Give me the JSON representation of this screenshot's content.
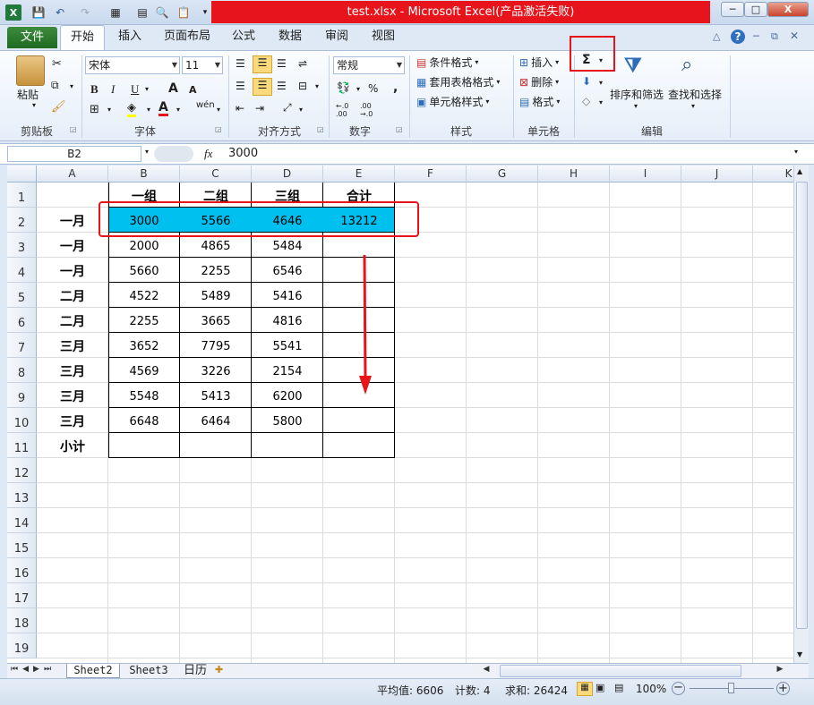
{
  "window": {
    "title": "test.xlsx  -  Microsoft Excel(产品激活失败)",
    "controls": {
      "minimize": "─",
      "maximize": "□",
      "close": "X"
    }
  },
  "ribbon_tabs": [
    "文件",
    "开始",
    "插入",
    "页面布局",
    "公式",
    "数据",
    "审阅",
    "视图"
  ],
  "clipboard": {
    "paste": "粘贴",
    "group": "剪贴板"
  },
  "font": {
    "name": "宋体",
    "size": "11",
    "bold": "B",
    "italic": "I",
    "underline": "U",
    "grow": "A",
    "shrink": "A",
    "color_letter": "A",
    "phonetic": "wén",
    "group": "字体"
  },
  "alignment": {
    "group": "对齐方式"
  },
  "number": {
    "format": "常规",
    "percent": "%",
    "comma": ",",
    "inc": "←.0 .00",
    "dec": ".00 →.0",
    "group": "数字"
  },
  "styles": {
    "conditional": "条件格式",
    "table": "套用表格格式",
    "cell": "单元格样式",
    "group": "样式"
  },
  "cells": {
    "insert": "插入",
    "delete": "删除",
    "format": "格式",
    "group": "单元格"
  },
  "editing": {
    "sum": "Σ",
    "sort": "排序和筛选",
    "find": "查找和选择",
    "group": "编辑"
  },
  "formula_bar": {
    "name_box": "B2",
    "fx": "fx",
    "value": "3000"
  },
  "columns": [
    "A",
    "B",
    "C",
    "D",
    "E",
    "F",
    "G",
    "H",
    "I",
    "J",
    "K"
  ],
  "rows": [
    "1",
    "2",
    "3",
    "4",
    "5",
    "6",
    "7",
    "8",
    "9",
    "10",
    "11",
    "12",
    "13",
    "14",
    "15",
    "16",
    "17",
    "18",
    "19"
  ],
  "table": {
    "header": [
      "",
      "一组",
      "二组",
      "三组",
      "合计"
    ],
    "data": [
      [
        "一月",
        "3000",
        "5566",
        "4646",
        "13212"
      ],
      [
        "一月",
        "2000",
        "4865",
        "5484",
        ""
      ],
      [
        "一月",
        "5660",
        "2255",
        "6546",
        ""
      ],
      [
        "二月",
        "4522",
        "5489",
        "5416",
        ""
      ],
      [
        "二月",
        "2255",
        "3665",
        "4816",
        ""
      ],
      [
        "三月",
        "3652",
        "7795",
        "5541",
        ""
      ],
      [
        "三月",
        "4569",
        "3226",
        "2154",
        ""
      ],
      [
        "三月",
        "5548",
        "5413",
        "6200",
        ""
      ],
      [
        "三月",
        "6648",
        "6464",
        "5800",
        ""
      ],
      [
        "小计",
        "",
        "",
        "",
        ""
      ]
    ]
  },
  "sheets": [
    "Sheet2",
    "Sheet3",
    "日历"
  ],
  "status": {
    "average": "平均值: 6606",
    "count": "计数: 4",
    "sum": "求和: 26424",
    "zoom": "100%"
  },
  "colors": {
    "selection_fill": "#00c0f0",
    "annotation_red": "#e8141b",
    "excel_green": "#217346"
  }
}
